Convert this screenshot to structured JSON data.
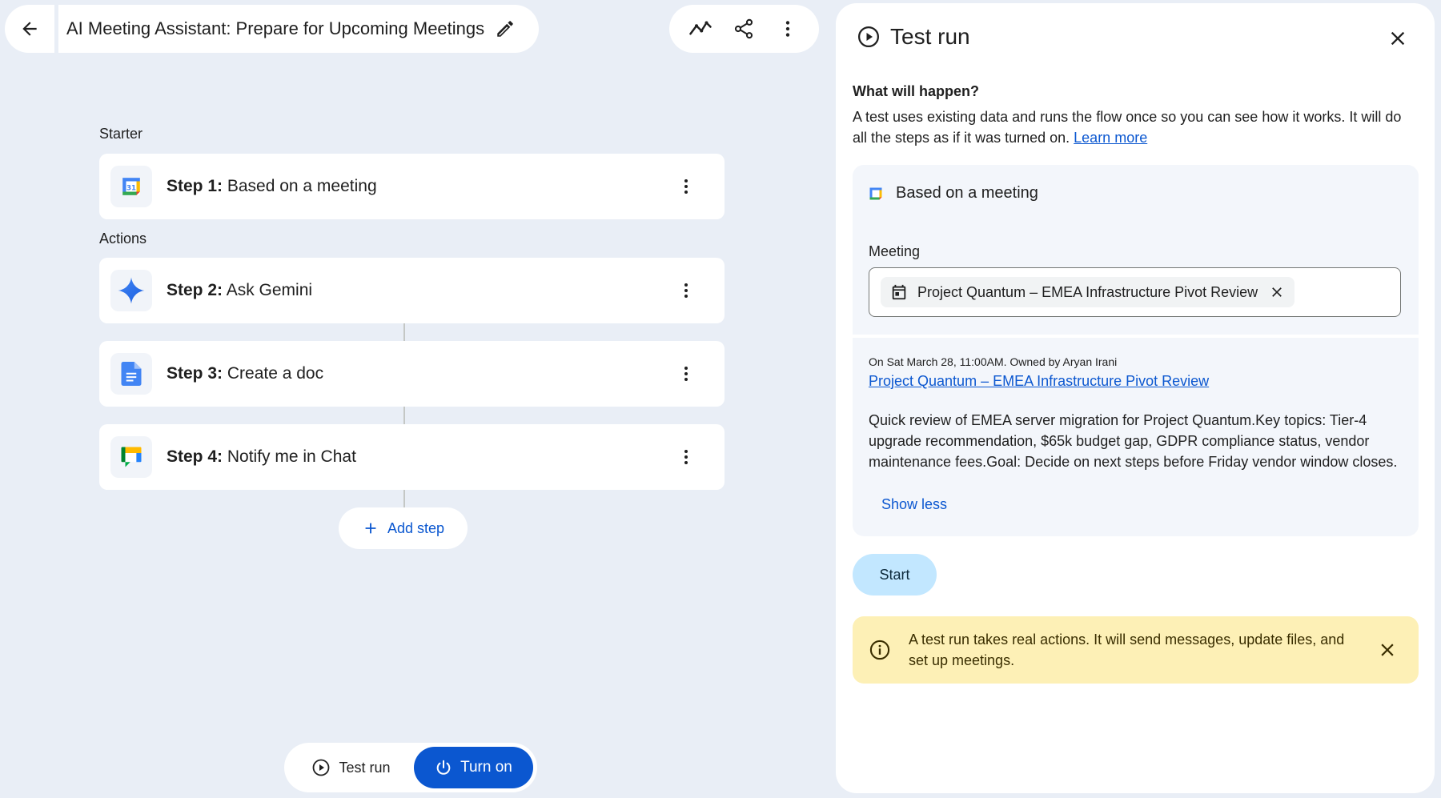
{
  "header": {
    "title": "AI Meeting Assistant: Prepare for Upcoming Meetings",
    "icons": [
      "arrow-back-icon",
      "edit-pencil-icon",
      "activity-icon",
      "share-icon",
      "more-vert-icon"
    ]
  },
  "flow": {
    "starter_label": "Starter",
    "actions_label": "Actions",
    "steps": [
      {
        "prefix": "Step 1:",
        "label": " Based on a meeting",
        "icon": "google-calendar-icon"
      },
      {
        "prefix": "Step 2:",
        "label": " Ask Gemini",
        "icon": "gemini-sparkle-icon"
      },
      {
        "prefix": "Step 3:",
        "label": " Create a doc",
        "icon": "google-docs-icon"
      },
      {
        "prefix": "Step 4:",
        "label": " Notify me in Chat",
        "icon": "google-chat-icon"
      }
    ],
    "add_step": "Add step"
  },
  "bottom_bar": {
    "test_run": "Test run",
    "turn_on": "Turn on"
  },
  "panel": {
    "title": "Test run",
    "what_title": "What will happen?",
    "what_desc": "A test uses existing data and runs the flow once so you can see how it works. It will do all the steps as if it was turned on. ",
    "learn_more": "Learn more",
    "trigger_label": "Based on a meeting",
    "meeting_label": "Meeting",
    "meeting_chip": "Project Quantum – EMEA Infrastructure Pivot Review",
    "meeting_meta": "On Sat March 28, 11:00AM. Owned by Aryan Irani",
    "meeting_link": "Project Quantum – EMEA Infrastructure Pivot Review",
    "meeting_desc": "Quick review of EMEA server migration for Project Quantum.Key topics: Tier-4 upgrade recommendation, $65k budget gap, GDPR compliance status, vendor maintenance fees.Goal: Decide on next steps before Friday vendor window closes.",
    "show_less": "Show less",
    "start": "Start",
    "warning": "A test run takes real actions. It will send messages, update files, and set up meetings."
  },
  "colors": {
    "background": "#e9eef6",
    "primary": "#0b57d0",
    "start_button": "#c2e7ff",
    "warning_bg": "#fdf0b6"
  }
}
